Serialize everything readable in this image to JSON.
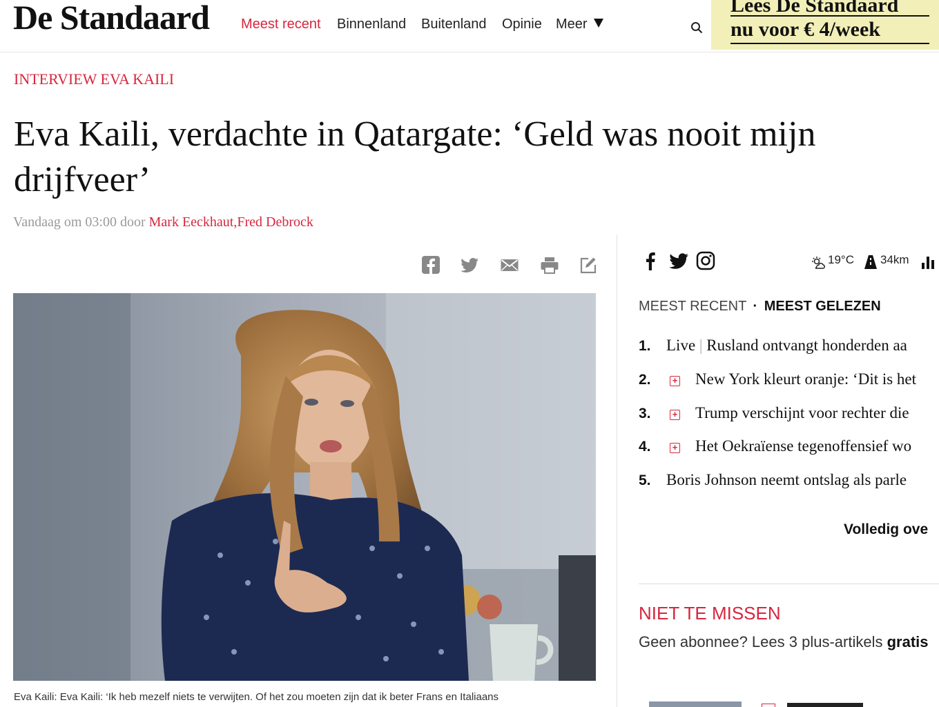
{
  "header": {
    "logo": "De Standaard",
    "nav": [
      "Meest recent",
      "Binnenland",
      "Buitenland",
      "Opinie",
      "Meer"
    ],
    "promo_line1": "Lees De Standaard",
    "promo_line2": "nu voor € 4/week",
    "colors": {
      "accent": "#d7263d",
      "promo_bg": "#f2efb8"
    }
  },
  "article": {
    "kicker": "INTERVIEW EVA KAILI",
    "title": "Eva Kaili, verdachte in Qatargate: ‘Geld was nooit mijn drijfveer’",
    "byline_prefix": "Vandaag om 03:00 door",
    "authors": "Mark Eeckhaut,Fred Debrock",
    "share_icons": [
      "facebook-icon",
      "twitter-icon",
      "mail-icon",
      "print-icon",
      "edit-icon"
    ],
    "caption": "Eva Kaili: Eva Kaili: ‘Ik heb mezelf niets te verwijten. Of het zou moeten zijn dat ik beter Frans en Italiaans"
  },
  "sidebar": {
    "weather_temp": "19°C",
    "distance": "34km",
    "tab_recent": "MEEST RECENT",
    "tab_sep": "·",
    "tab_read": "MEEST GELEZEN",
    "items": [
      {
        "rank": "1.",
        "prefix": "Live",
        "sep": "|",
        "text": "Rusland ontvangt honderden aa",
        "plus": false
      },
      {
        "rank": "2.",
        "text": "New York kleurt oranje: ‘Dit is het",
        "plus": true
      },
      {
        "rank": "3.",
        "text": "Trump verschijnt voor rechter die",
        "plus": true
      },
      {
        "rank": "4.",
        "text": "Het Oekraïense tegenoffensief wo",
        "plus": true
      },
      {
        "rank": "5.",
        "text": "Boris Johnson neemt ontslag als parle",
        "plus": false
      }
    ],
    "full_link": "Volledig ove",
    "niet_te_missen": "NIET TE MISSEN",
    "geen_prefix": "Geen abonnee? Lees 3 plus-artikels",
    "geen_bold": "gratis"
  }
}
